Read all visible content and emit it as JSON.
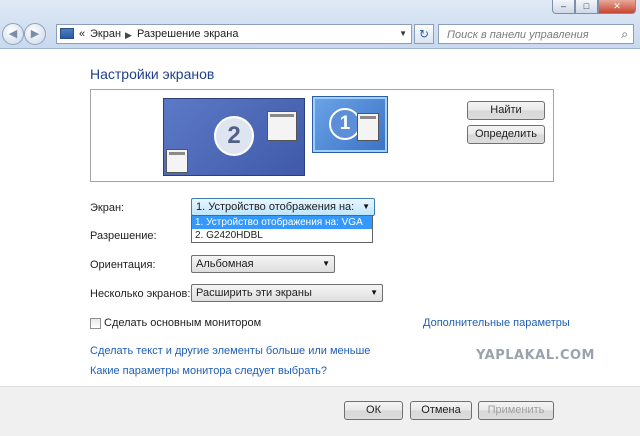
{
  "window": {
    "controls": {
      "minimize": "–",
      "maximize": "□",
      "close": "✕"
    }
  },
  "nav": {
    "back_icon": "arrow-left-icon",
    "forward_icon": "arrow-right-icon",
    "back_glyph": "◀",
    "forward_glyph": "▶"
  },
  "address": {
    "chevrons": "«",
    "crumb_1": "Экран",
    "crumb_sep": "▶",
    "crumb_2": "Разрешение экрана",
    "dropdown_glyph": "▼",
    "refresh_glyph": "↻"
  },
  "search": {
    "placeholder": "Поиск в панели управления",
    "icon_glyph": "⌕"
  },
  "page": {
    "title": "Настройки экранов"
  },
  "preview": {
    "monitor_2_number": "2",
    "monitor_1_number": "1",
    "find_button": "Найти",
    "identify_button": "Определить"
  },
  "form": {
    "screen_label": "Экран:",
    "screen_value": "1. Устройство отображения на: VGA",
    "screen_options": [
      "1. Устройство отображения на: VGA",
      "2. G2420HDBL"
    ],
    "resolution_label": "Разрешение:",
    "orientation_label": "Ориентация:",
    "orientation_value": "Альбомная",
    "multi_label": "Несколько экранов:",
    "multi_value": "Расширить эти экраны",
    "main_monitor_label": "Сделать основным монитором",
    "advanced_link": "Дополнительные параметры",
    "combo_arrow": "▼"
  },
  "links": {
    "text_size": "Сделать текст и другие элементы больше или меньше",
    "which_params": "Какие параметры монитора следует выбрать?"
  },
  "footer": {
    "ok_button": "ОК",
    "cancel_button": "Отмена",
    "apply_button": "Применить"
  },
  "watermark": "YAPLAKAL.COM"
}
